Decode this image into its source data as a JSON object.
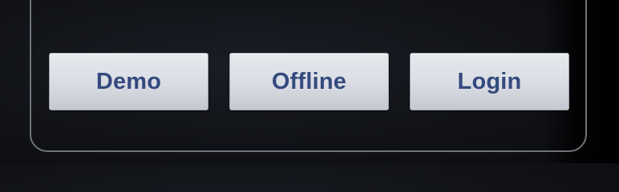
{
  "buttons": {
    "demo_label": "Demo",
    "offline_label": "Offline",
    "login_label": "Login"
  },
  "colors": {
    "button_text": "#344a7e",
    "panel_border": "#6f7278",
    "background": "#111318"
  }
}
